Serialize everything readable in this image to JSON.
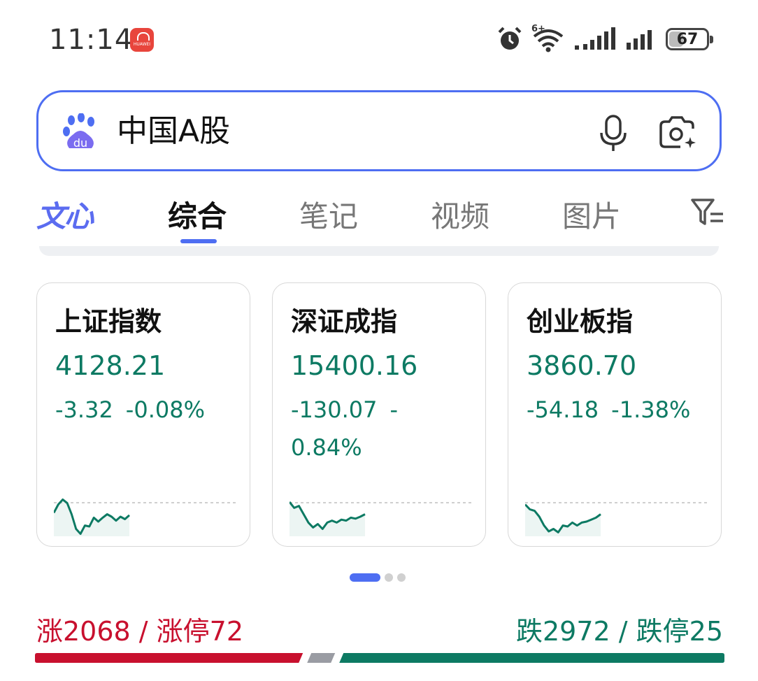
{
  "status_bar": {
    "time": "11:14",
    "app_badge": "HUAWEI",
    "icons": [
      "alarm-icon",
      "wifi-icon",
      "signal-icon",
      "signal-icon"
    ],
    "wifi_label": "6+",
    "battery_level": "67"
  },
  "search": {
    "logo": "baidu-paw-icon",
    "logo_text": "du",
    "query": "中国A股",
    "accent": "#4e6ef2"
  },
  "tabs": [
    {
      "label": "文心",
      "active": false
    },
    {
      "label": "综合",
      "active": true
    },
    {
      "label": "笔记",
      "active": false
    },
    {
      "label": "视频",
      "active": false
    },
    {
      "label": "图片",
      "active": false
    }
  ],
  "indices": [
    {
      "name": "上证指数",
      "price": "4128.21",
      "change": "-3.32",
      "change_pct": "-0.08%",
      "trend": [
        0.52,
        0.35,
        0.25,
        0.32,
        0.55,
        0.85,
        0.95,
        0.78,
        0.8,
        0.62,
        0.7,
        0.62,
        0.55,
        0.6,
        0.68,
        0.6,
        0.65,
        0.57
      ]
    },
    {
      "name": "深证成指",
      "price": "15400.16",
      "change": "-130.07",
      "change_pct": "-0.84%",
      "trend": [
        0.3,
        0.42,
        0.38,
        0.55,
        0.72,
        0.82,
        0.75,
        0.85,
        0.72,
        0.68,
        0.72,
        0.66,
        0.68,
        0.62,
        0.64,
        0.6,
        0.55
      ]
    },
    {
      "name": "创业板指",
      "price": "3860.70",
      "change": "-54.18",
      "change_pct": "-1.38%",
      "trend": [
        0.35,
        0.45,
        0.48,
        0.6,
        0.78,
        0.9,
        0.85,
        0.92,
        0.78,
        0.8,
        0.72,
        0.78,
        0.72,
        0.7,
        0.66,
        0.62,
        0.55
      ]
    }
  ],
  "pager": {
    "count": 3,
    "active": 0
  },
  "breadth": {
    "up_text": "涨2068 / 涨停72",
    "down_text": "跌2972 / 跌停25",
    "up_color": "#c8102e",
    "down_color": "#0d7a63",
    "flat_color": "#9a9ca3"
  }
}
